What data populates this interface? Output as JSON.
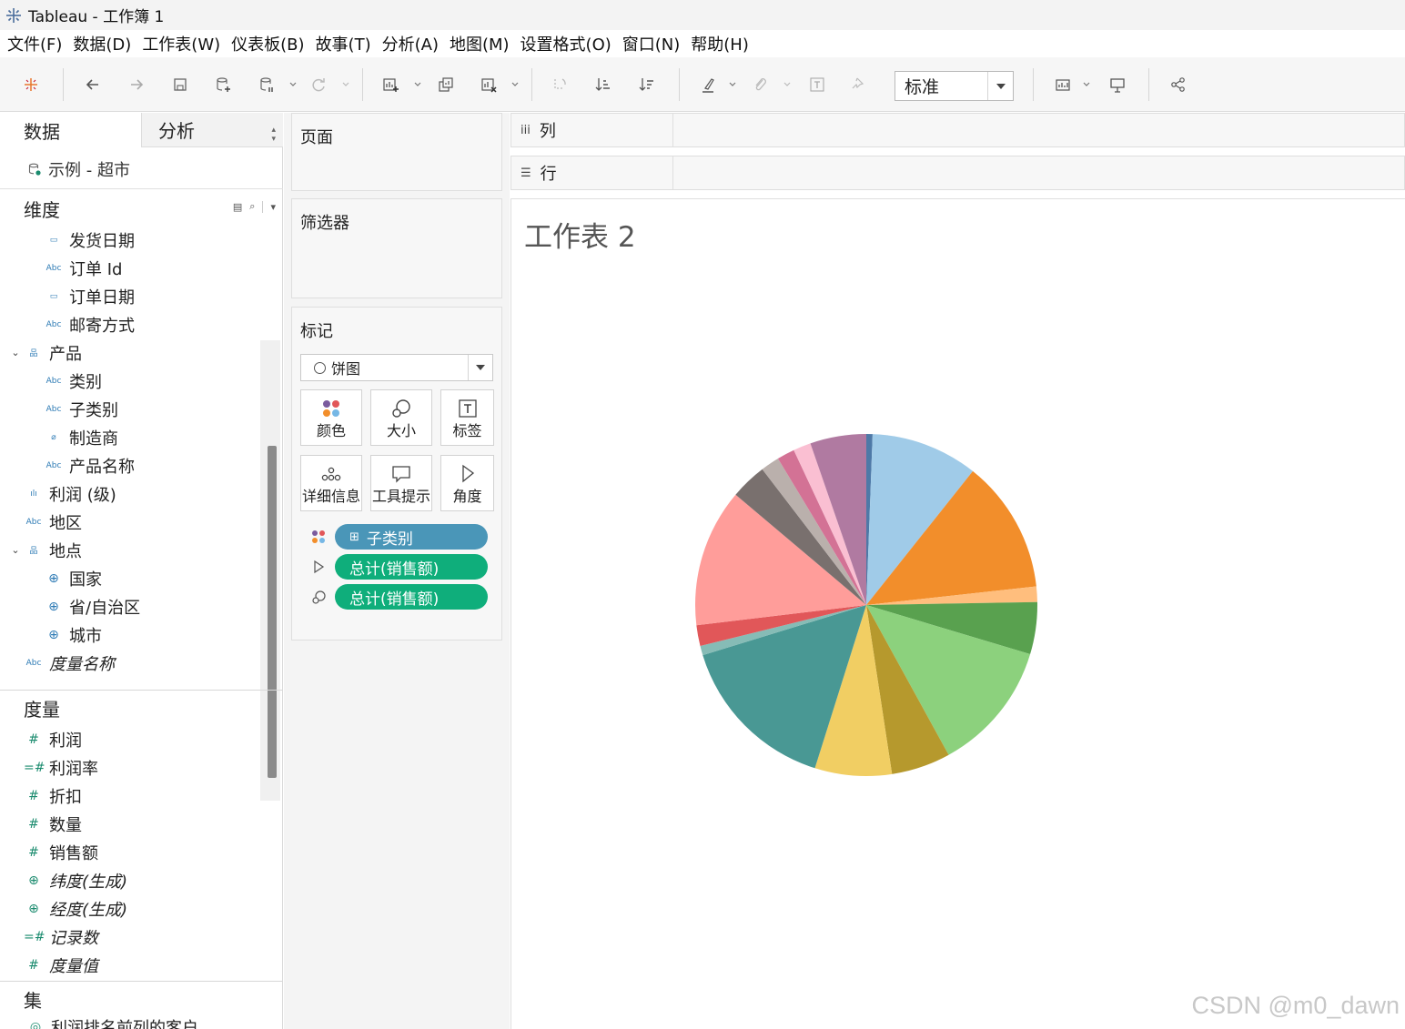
{
  "window": {
    "title": "Tableau - 工作簿 1"
  },
  "menu": [
    "文件(F)",
    "数据(D)",
    "工作表(W)",
    "仪表板(B)",
    "故事(T)",
    "分析(A)",
    "地图(M)",
    "设置格式(O)",
    "窗口(N)",
    "帮助(H)"
  ],
  "toolbar": {
    "fit_value": "标准"
  },
  "data_pane": {
    "tab_data": "数据",
    "tab_analysis": "分析",
    "datasource": "示例 - 超市",
    "dimensions_header": "维度",
    "dimensions": [
      {
        "label": "发货日期",
        "icon": "calendar-icon",
        "glyph": "▭",
        "indent": 2,
        "italic": false
      },
      {
        "label": "订单 Id",
        "icon": "abc-icon",
        "glyph": "Abc",
        "indent": 2,
        "italic": false
      },
      {
        "label": "订单日期",
        "icon": "calendar-icon",
        "glyph": "▭",
        "indent": 2,
        "italic": false
      },
      {
        "label": "邮寄方式",
        "icon": "abc-icon",
        "glyph": "Abc",
        "indent": 2,
        "italic": false
      },
      {
        "label": "产品",
        "icon": "hierarchy-icon",
        "glyph": "品",
        "indent": 1,
        "italic": false,
        "caret": "⌄"
      },
      {
        "label": "类别",
        "icon": "abc-icon",
        "glyph": "Abc",
        "indent": 2,
        "italic": false
      },
      {
        "label": "子类别",
        "icon": "abc-icon",
        "glyph": "Abc",
        "indent": 2,
        "italic": false
      },
      {
        "label": "制造商",
        "icon": "paperclip-icon",
        "glyph": "⌀",
        "indent": 2,
        "italic": false
      },
      {
        "label": "产品名称",
        "icon": "abc-icon",
        "glyph": "Abc",
        "indent": 2,
        "italic": false
      },
      {
        "label": "利润 (级)",
        "icon": "bins-icon",
        "glyph": "ılı",
        "indent": 1,
        "italic": false
      },
      {
        "label": "地区",
        "icon": "abc-icon",
        "glyph": "Abc",
        "indent": 1,
        "italic": false
      },
      {
        "label": "地点",
        "icon": "hierarchy-icon",
        "glyph": "品",
        "indent": 1,
        "italic": false,
        "caret": "⌄"
      },
      {
        "label": "国家",
        "icon": "globe-icon",
        "glyph": "⊕",
        "indent": 2,
        "italic": false
      },
      {
        "label": "省/自治区",
        "icon": "globe-icon",
        "glyph": "⊕",
        "indent": 2,
        "italic": false
      },
      {
        "label": "城市",
        "icon": "globe-icon",
        "glyph": "⊕",
        "indent": 2,
        "italic": false
      },
      {
        "label": "度量名称",
        "icon": "abc-icon",
        "glyph": "Abc",
        "indent": 1,
        "italic": true
      }
    ],
    "measures_header": "度量",
    "measures": [
      {
        "label": "利润",
        "icon": "number-icon",
        "glyph": "#",
        "italic": false
      },
      {
        "label": "利润率",
        "icon": "calc-number-icon",
        "glyph": "=#",
        "italic": false
      },
      {
        "label": "折扣",
        "icon": "number-icon",
        "glyph": "#",
        "italic": false
      },
      {
        "label": "数量",
        "icon": "number-icon",
        "glyph": "#",
        "italic": false
      },
      {
        "label": "销售额",
        "icon": "number-icon",
        "glyph": "#",
        "italic": false
      },
      {
        "label": "纬度(生成)",
        "icon": "globe-icon",
        "glyph": "⊕",
        "italic": true
      },
      {
        "label": "经度(生成)",
        "icon": "globe-icon",
        "glyph": "⊕",
        "italic": true
      },
      {
        "label": "记录数",
        "icon": "calc-number-icon",
        "glyph": "=#",
        "italic": true
      },
      {
        "label": "度量值",
        "icon": "number-icon",
        "glyph": "#",
        "italic": true
      }
    ],
    "sets_header": "集",
    "sets_partial": "利润排名前列的客户"
  },
  "cards": {
    "pages": "页面",
    "filters": "筛选器",
    "marks": "标记",
    "mark_type": "饼图",
    "mark_buttons": {
      "color": "颜色",
      "size": "大小",
      "label": "标签",
      "detail": "详细信息",
      "tooltip": "工具提示",
      "angle": "角度"
    },
    "pills": [
      {
        "label": "子类别",
        "prefix": "⊞",
        "color": "#4a96b8",
        "icon": "color-dots-icon"
      },
      {
        "label": "总计(销售额)",
        "prefix": "",
        "color": "#0fae7b",
        "icon": "angle-icon"
      },
      {
        "label": "总计(销售额)",
        "prefix": "",
        "color": "#0fae7b",
        "icon": "size-icon"
      }
    ]
  },
  "shelves": {
    "columns": "列",
    "rows": "行"
  },
  "view": {
    "sheet_title": "工作表 2",
    "watermark": "CSDN @m0_dawn"
  },
  "chart_data": {
    "type": "pie",
    "title": "工作表 2",
    "color_field": "子类别",
    "angle_field": "总计(销售额)",
    "size_field": "总计(销售额)",
    "slices": [
      {
        "share": 0.6,
        "color": "#4e79a7"
      },
      {
        "share": 10.3,
        "color": "#a0cbe8"
      },
      {
        "share": 12.8,
        "color": "#f28e2b"
      },
      {
        "share": 1.5,
        "color": "#ffbe7d"
      },
      {
        "share": 5.0,
        "color": "#59a14f"
      },
      {
        "share": 12.6,
        "color": "#8cd17d"
      },
      {
        "share": 5.7,
        "color": "#b6992d"
      },
      {
        "share": 7.4,
        "color": "#f1ce63"
      },
      {
        "share": 15.7,
        "color": "#499894"
      },
      {
        "share": 0.9,
        "color": "#86bcb6"
      },
      {
        "share": 2.0,
        "color": "#e15759"
      },
      {
        "share": 13.3,
        "color": "#ff9d9a"
      },
      {
        "share": 3.5,
        "color": "#79706e"
      },
      {
        "share": 1.8,
        "color": "#bab0ac"
      },
      {
        "share": 1.7,
        "color": "#d37295"
      },
      {
        "share": 1.7,
        "color": "#fabfd2"
      },
      {
        "share": 5.4,
        "color": "#b07aa1"
      }
    ]
  }
}
